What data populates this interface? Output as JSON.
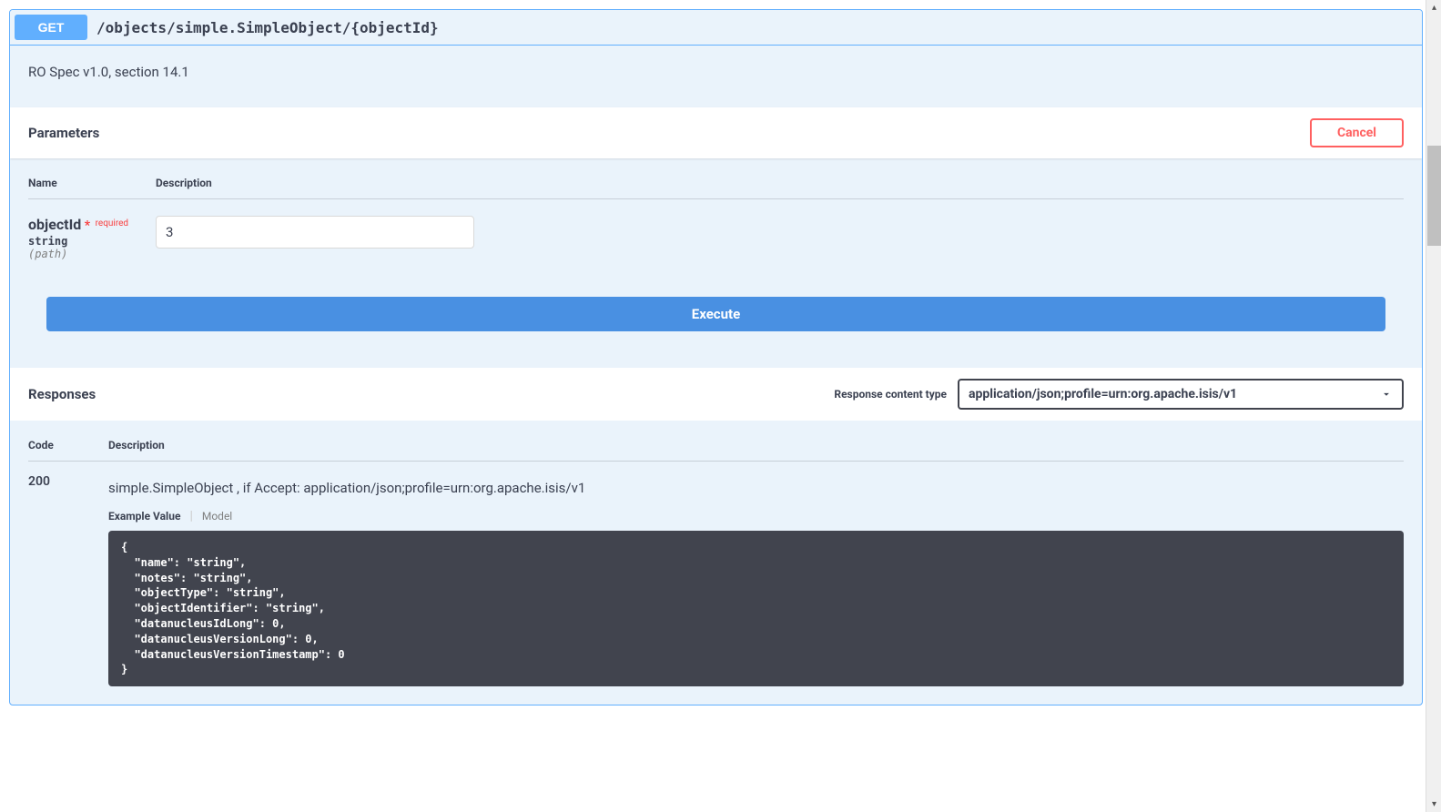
{
  "header": {
    "method": "GET",
    "path": "/objects/simple.SimpleObject/{objectId}",
    "description": "RO Spec v1.0, section 14.1"
  },
  "parameters": {
    "title": "Parameters",
    "cancel_label": "Cancel",
    "name_header": "Name",
    "desc_header": "Description",
    "items": [
      {
        "name": "objectId",
        "required_star": "*",
        "required_text": "required",
        "type": "string",
        "in": "(path)",
        "value": "3"
      }
    ]
  },
  "execute_label": "Execute",
  "responses": {
    "title": "Responses",
    "content_type_label": "Response content type",
    "content_type_value": "application/json;profile=urn:org.apache.isis/v1",
    "code_header": "Code",
    "desc_header": "Description",
    "items": [
      {
        "code": "200",
        "description": "simple.SimpleObject , if Accept: application/json;profile=urn:org.apache.isis/v1",
        "tab_example": "Example Value",
        "tab_model": "Model",
        "example": "{\n  \"name\": \"string\",\n  \"notes\": \"string\",\n  \"objectType\": \"string\",\n  \"objectIdentifier\": \"string\",\n  \"datanucleusIdLong\": 0,\n  \"datanucleusVersionLong\": 0,\n  \"datanucleusVersionTimestamp\": 0\n}"
      }
    ]
  }
}
